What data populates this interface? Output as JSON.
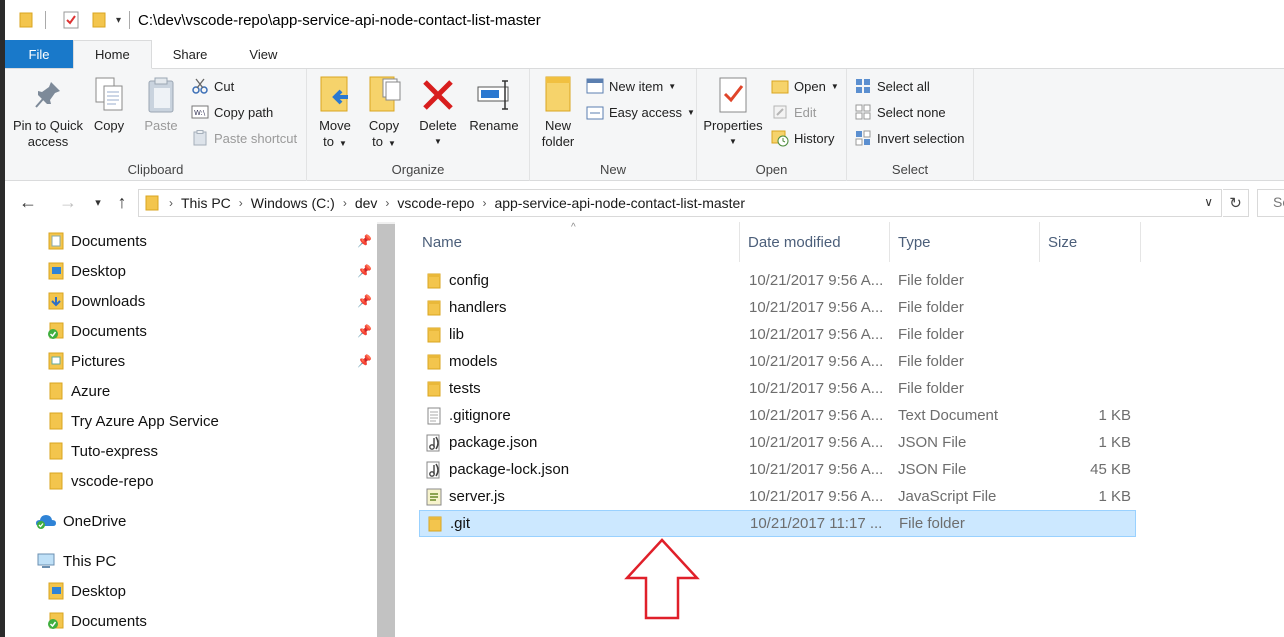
{
  "titlebar": {
    "path": "C:\\dev\\vscode-repo\\app-service-api-node-contact-list-master"
  },
  "tabs": [
    {
      "label": "File"
    },
    {
      "label": "Home"
    },
    {
      "label": "Share"
    },
    {
      "label": "View"
    }
  ],
  "ribbon": {
    "clipboard": {
      "label": "Clipboard",
      "pin_line1": "Pin to Quick",
      "pin_line2": "access",
      "copy": "Copy",
      "paste": "Paste",
      "cut": "Cut",
      "copy_path": "Copy path",
      "paste_shortcut": "Paste shortcut"
    },
    "organize": {
      "label": "Organize",
      "move_line1": "Move",
      "move_line2": "to",
      "copy_line1": "Copy",
      "copy_line2": "to",
      "delete": "Delete",
      "rename": "Rename"
    },
    "new": {
      "label": "New",
      "new_folder_line1": "New",
      "new_folder_line2": "folder",
      "new_item": "New item",
      "easy_access": "Easy access"
    },
    "open": {
      "label": "Open",
      "properties": "Properties",
      "open": "Open",
      "edit": "Edit",
      "history": "History"
    },
    "select": {
      "label": "Select",
      "select_all": "Select all",
      "select_none": "Select none",
      "invert": "Invert selection"
    }
  },
  "address": {
    "crumbs": [
      "This PC",
      "Windows (C:)",
      "dev",
      "vscode-repo",
      "app-service-api-node-contact-list-master"
    ],
    "search_text": "Se"
  },
  "navpane": {
    "items": [
      {
        "label": "Documents",
        "pinned": true
      },
      {
        "label": "Desktop",
        "pinned": true
      },
      {
        "label": "Downloads",
        "pinned": true
      },
      {
        "label": "Documents",
        "pinned": true
      },
      {
        "label": "Pictures",
        "pinned": true
      },
      {
        "label": "Azure"
      },
      {
        "label": "Try Azure App Service"
      },
      {
        "label": "Tuto-express"
      },
      {
        "label": "vscode-repo"
      },
      {
        "label": "OneDrive"
      },
      {
        "label": "This PC"
      },
      {
        "label": "Desktop"
      },
      {
        "label": "Documents"
      }
    ]
  },
  "filelist": {
    "columns": {
      "name": "Name",
      "date": "Date modified",
      "type": "Type",
      "size": "Size"
    },
    "rows": [
      {
        "name": "config",
        "date": "10/21/2017 9:56 A...",
        "type": "File folder",
        "size": ""
      },
      {
        "name": "handlers",
        "date": "10/21/2017 9:56 A...",
        "type": "File folder",
        "size": ""
      },
      {
        "name": "lib",
        "date": "10/21/2017 9:56 A...",
        "type": "File folder",
        "size": ""
      },
      {
        "name": "models",
        "date": "10/21/2017 9:56 A...",
        "type": "File folder",
        "size": ""
      },
      {
        "name": "tests",
        "date": "10/21/2017 9:56 A...",
        "type": "File folder",
        "size": ""
      },
      {
        "name": ".gitignore",
        "date": "10/21/2017 9:56 A...",
        "type": "Text Document",
        "size": "1 KB"
      },
      {
        "name": "package.json",
        "date": "10/21/2017 9:56 A...",
        "type": "JSON File",
        "size": "1 KB"
      },
      {
        "name": "package-lock.json",
        "date": "10/21/2017 9:56 A...",
        "type": "JSON File",
        "size": "45 KB"
      },
      {
        "name": "server.js",
        "date": "10/21/2017 9:56 A...",
        "type": "JavaScript File",
        "size": "1 KB"
      },
      {
        "name": ".git",
        "date": "10/21/2017 11:17 ...",
        "type": "File folder",
        "size": ""
      }
    ]
  },
  "colors": {
    "file_tab": "#1979ca",
    "selection": "#cce8ff",
    "annotation_arrow": "#e0202a",
    "folder": "#f3c54d"
  }
}
